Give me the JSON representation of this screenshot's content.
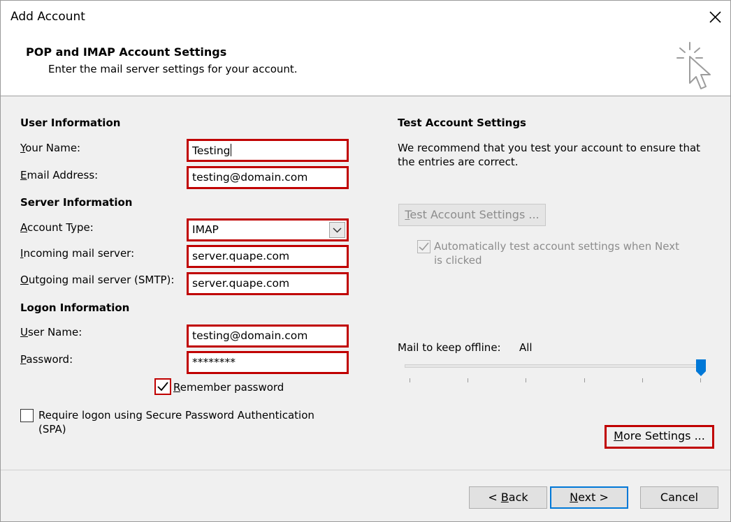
{
  "window": {
    "title": "Add Account"
  },
  "header": {
    "title": "POP and IMAP Account Settings",
    "subtitle": "Enter the mail server settings for your account."
  },
  "user_info": {
    "section": "User Information",
    "your_name_label": "Your Name:",
    "your_name_value": "Testing",
    "email_label": "Email Address:",
    "email_value": "testing@domain.com"
  },
  "server_info": {
    "section": "Server Information",
    "account_type_label": "Account Type:",
    "account_type_value": "IMAP",
    "incoming_label": "Incoming mail server:",
    "incoming_value": "server.quape.com",
    "outgoing_label": "Outgoing mail server (SMTP):",
    "outgoing_value": "server.quape.com"
  },
  "logon_info": {
    "section": "Logon Information",
    "username_label": "User Name:",
    "username_value": "testing@domain.com",
    "password_label": "Password:",
    "password_value": "********",
    "remember_label": "Remember password",
    "remember_checked": true,
    "spa_label_line1": "Require logon using Secure Password Authentication",
    "spa_label_line2": "(SPA)",
    "spa_checked": false
  },
  "test_settings": {
    "section": "Test Account Settings",
    "desc_line1": "We recommend that you test your account to ensure that",
    "desc_line2": "the entries are correct.",
    "button_label": "Test Account Settings ...",
    "auto_test_line1": "Automatically test account settings when Next",
    "auto_test_line2": "is clicked",
    "auto_test_checked": true
  },
  "offline": {
    "label": "Mail to keep offline:",
    "value": "All",
    "slider_level": 1.0
  },
  "buttons": {
    "more_settings": "More Settings ...",
    "back": "< Back",
    "next": "Next >",
    "cancel": "Cancel"
  },
  "colors": {
    "highlight": "#c00000",
    "default_button": "#0078d7"
  }
}
